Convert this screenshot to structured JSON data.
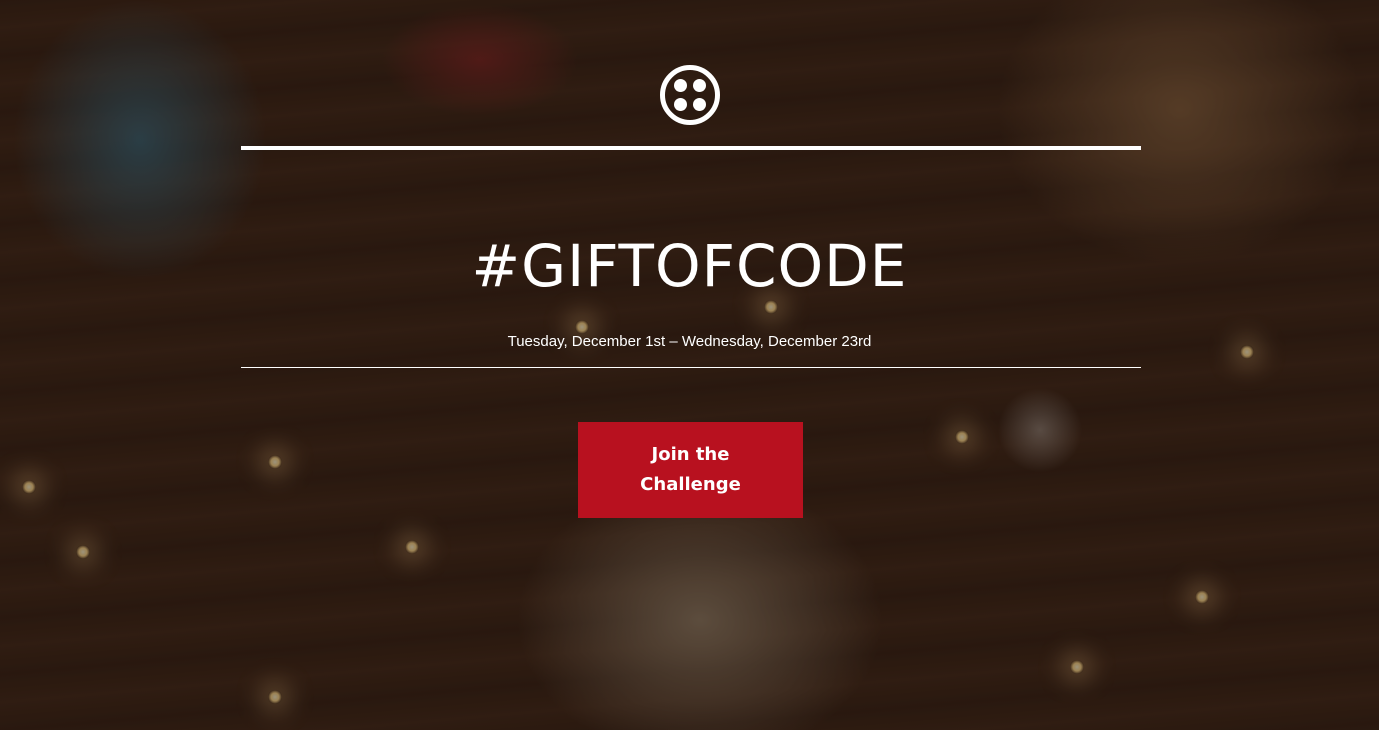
{
  "logo": {
    "icon": "twilio-logo-icon"
  },
  "hero": {
    "title": "#GIFTOFCODE",
    "date_range": "Tuesday, December 1st – Wednesday, December 23rd"
  },
  "cta": {
    "label": "Join the Challenge"
  },
  "colors": {
    "accent": "#b8111f",
    "text": "#ffffff"
  }
}
